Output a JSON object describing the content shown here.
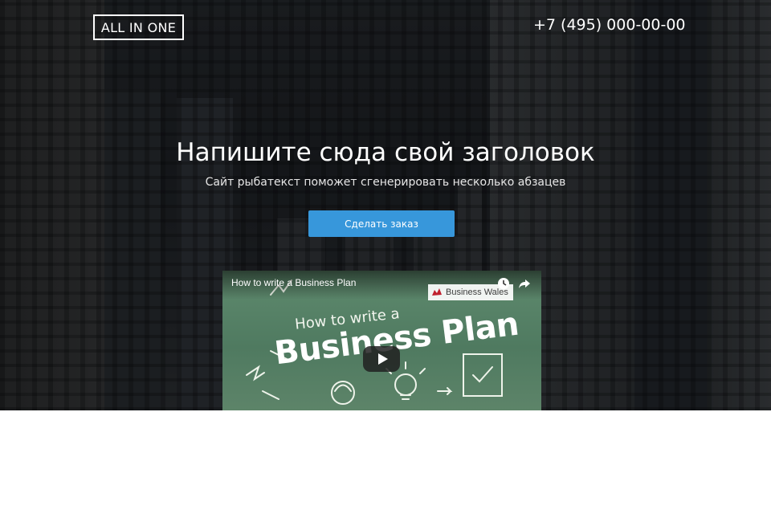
{
  "header": {
    "logo_text": "ALL IN ONE",
    "phone": "+7 (495) 000-00-00"
  },
  "hero": {
    "headline": "Напишите сюда свой заголовок",
    "subline": "Сайт рыбатекст поможет сгенерировать несколько абзацев",
    "cta_label": "Сделать заказ",
    "cta_color": "#3797db"
  },
  "video": {
    "title": "How to write a Business Plan",
    "brand": "Business Wales",
    "thumbnail_line1": "How to write a",
    "thumbnail_line2": "Business Plan",
    "icons": [
      "clock-icon",
      "share-icon",
      "play-icon"
    ]
  }
}
